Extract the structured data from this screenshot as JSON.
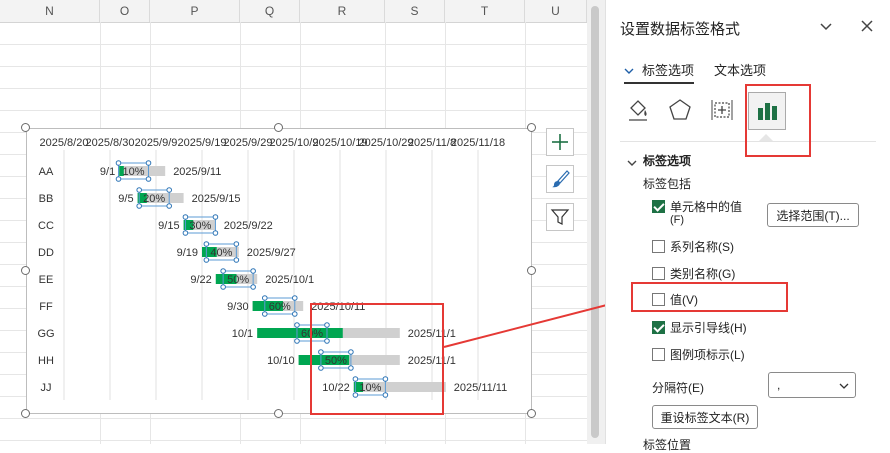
{
  "sheet": {
    "columns": [
      "N",
      "O",
      "P",
      "Q",
      "R",
      "S",
      "T",
      "U"
    ]
  },
  "chart_data": {
    "type": "bar",
    "subtype": "stacked-horizontal-gantt",
    "categories": [
      "AA",
      "BB",
      "CC",
      "DD",
      "EE",
      "FF",
      "GG",
      "HH",
      "JJ"
    ],
    "x_tick_labels": [
      "2025/8/20",
      "2025/8/30",
      "2025/9/9",
      "2025/9/19",
      "2025/9/29",
      "2025/10/9",
      "2025/10/19",
      "2025/10/29",
      "2025/11/8",
      "2025/11/18"
    ],
    "xlim": [
      "2025/8/20",
      "2025/11/18"
    ],
    "tick_step_days": 10,
    "series": [
      {
        "name": "",
        "color": "#00a651",
        "start_labels": [
          "9/1",
          "9/5",
          "9/15",
          "9/19",
          "9/22",
          "9/30",
          "10/1",
          "10/10",
          "10/22"
        ]
      },
      {
        "name": "",
        "color": "#d0d0d0",
        "end_labels": [
          "2025/9/11",
          "2025/9/15",
          "2025/9/22",
          "2025/9/27",
          "2025/10/1",
          "2025/10/11",
          "2025/11/1",
          "2025/11/1",
          "2025/11/11"
        ]
      }
    ],
    "percent_labels": [
      "10%",
      "20%",
      "30%",
      "40%",
      "50%",
      "60%",
      "60%",
      "50%",
      "10%"
    ],
    "progress": [
      0.1,
      0.2,
      0.3,
      0.4,
      0.5,
      0.6,
      0.6,
      0.5,
      0.1
    ],
    "grid": true
  },
  "chart_buttons": {
    "elements": "plus-icon",
    "styles": "brush-icon",
    "filters": "funnel-icon"
  },
  "panel": {
    "title": "设置数据标签格式",
    "tabs": [
      "标签选项",
      "文本选项"
    ],
    "section": "标签选项",
    "contains_label": "标签包括",
    "options": [
      {
        "label": "单元格中的值",
        "accel": "(F)",
        "checked": true
      },
      {
        "label": "系列名称(S)",
        "checked": false
      },
      {
        "label": "类别名称(G)",
        "checked": false
      },
      {
        "label": "值(V)",
        "checked": false
      },
      {
        "label": "显示引导线(H)",
        "checked": true
      },
      {
        "label": "图例项标示(L)",
        "checked": false
      }
    ],
    "select_range_button": "选择范围(T)...",
    "separator_label": "分隔符(E)",
    "separator_value": ",",
    "reset_button": "重设标签文本(R)",
    "label_position": "标签位置"
  },
  "colors": {
    "accent": "#1e7145",
    "highlight": "#e53935",
    "bar_done": "#00a651",
    "bar_rest": "#d0d0d0"
  }
}
